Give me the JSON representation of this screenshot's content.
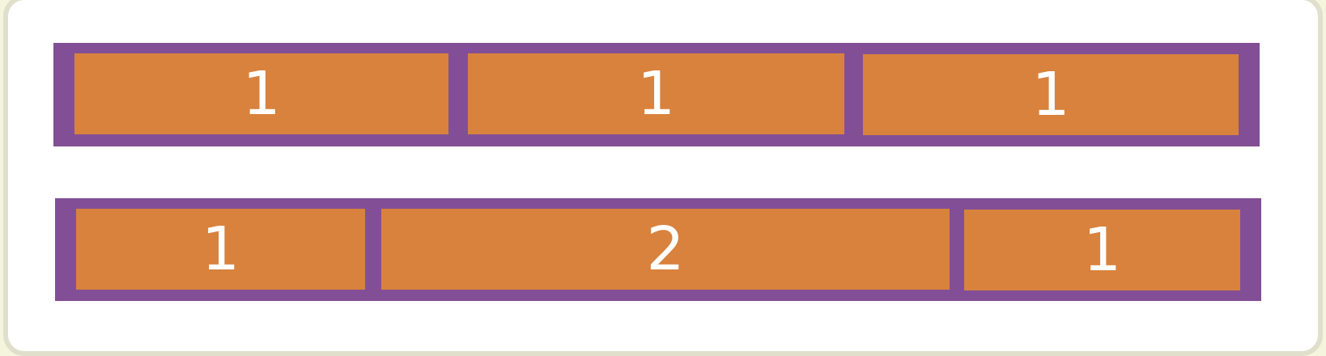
{
  "colors": {
    "container": "#824f96",
    "item": "#d9823d",
    "text": "#ffffff",
    "background": "#ffffff",
    "frame": "#e0dfcc"
  },
  "rows": [
    {
      "items": [
        {
          "label": "1"
        },
        {
          "label": "1"
        },
        {
          "label": "1"
        }
      ]
    },
    {
      "items": [
        {
          "label": "1"
        },
        {
          "label": "2"
        },
        {
          "label": "1"
        }
      ]
    }
  ]
}
